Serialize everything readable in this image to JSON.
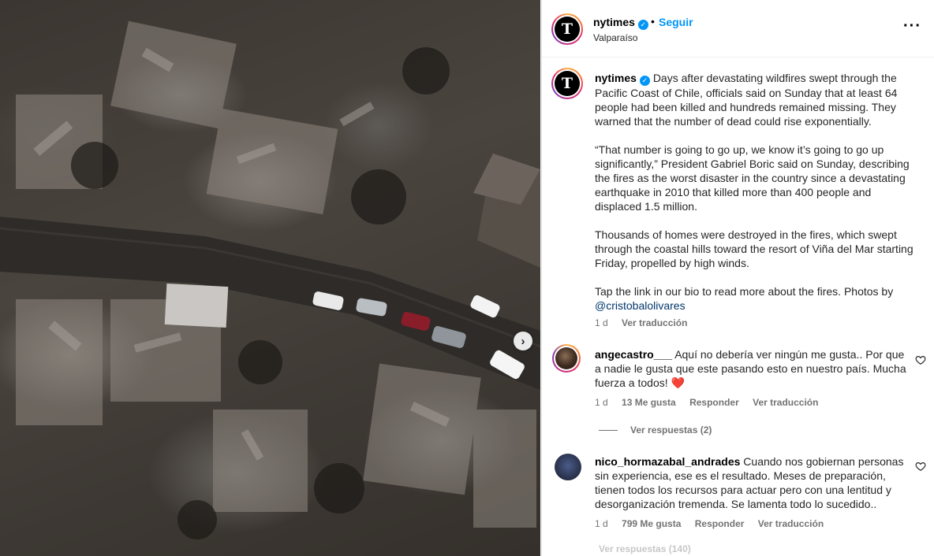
{
  "post": {
    "username": "nytimes",
    "avatar_letter": "T",
    "dot": "•",
    "follow_label": "Seguir",
    "location": "Valparaíso",
    "more_icon": "···",
    "next_icon": "›"
  },
  "caption": {
    "username": "nytimes",
    "p1": "Days after devastating wildfires swept through the Pacific Coast of Chile, officials said on Sunday that at least 64 people had been killed and hundreds remained missing. They warned that the number of dead could rise exponentially.",
    "p2": "“That number is going to go up, we know it’s going to go up significantly,” President Gabriel Boric said on Sunday, describing the fires as the worst disaster in the country since a devastating earthquake in 2010 that killed more than 400 people and displaced 1.5 million.",
    "p3": "Thousands of homes were destroyed in the fires, which swept through the coastal hills toward the resort of Viña del Mar starting Friday, propelled by high winds.",
    "p4": "Tap the link in our bio to read more about the fires. Photos by",
    "mention": "@cristobalolivares",
    "time": "1 d",
    "translate": "Ver traducción"
  },
  "comments": [
    {
      "username": "angecastro___",
      "text": "Aquí no debería ver ningún me gusta.. Por que a nadie le gusta que este pasando esto en nuestro país. Mucha fuerza a todos!",
      "emoji": "❤️",
      "time": "1 d",
      "likes": "13 Me gusta",
      "reply": "Responder",
      "translate": "Ver traducción",
      "replies": "Ver respuestas (2)"
    },
    {
      "username": "nico_hormazabal_andrades",
      "text": "Cuando nos gobiernan personas sin experiencia, ese es el resultado. Meses de preparación, tienen todos los recursos para actuar pero con una lentitud y desorganización tremenda. Se lamenta todo lo sucedido..",
      "time": "1 d",
      "likes": "799 Me gusta",
      "reply": "Responder",
      "translate": "Ver traducción",
      "replies": "Ver respuestas (140)"
    }
  ],
  "colors": {
    "accent": "#0095f6",
    "link": "#00376b",
    "muted": "#737373",
    "heart": "#ed4956"
  }
}
